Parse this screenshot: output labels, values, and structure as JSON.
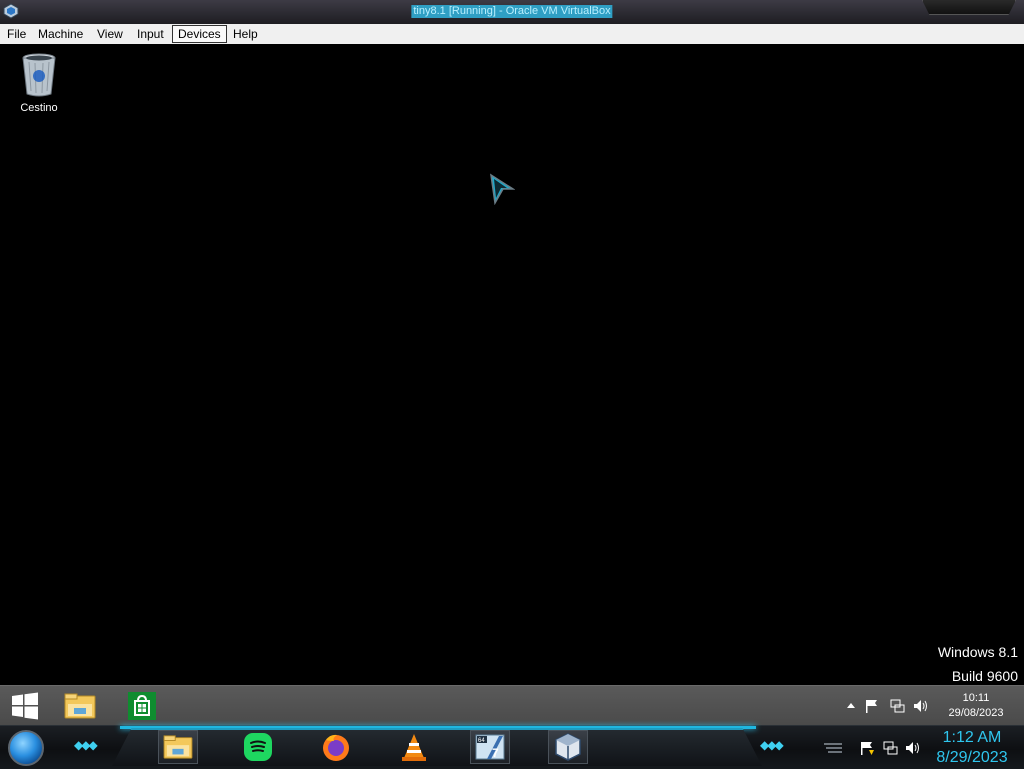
{
  "window": {
    "title": "tiny8.1 [Running] - Oracle VM VirtualBox"
  },
  "menubar": {
    "items": [
      {
        "label": "File"
      },
      {
        "label": "Machine"
      },
      {
        "label": "View"
      },
      {
        "label": "Input"
      },
      {
        "label": "Devices",
        "active": true
      },
      {
        "label": "Help"
      }
    ]
  },
  "desktop": {
    "icons": [
      {
        "label": "Cestino",
        "icon": "recycle-bin-icon"
      }
    ],
    "watermark": {
      "os": "Windows 8.1",
      "build": "Build 9600"
    }
  },
  "guest_taskbar": {
    "pinned": [
      {
        "icon": "windows-start-icon"
      },
      {
        "icon": "file-explorer-icon"
      },
      {
        "icon": "windows-store-icon"
      }
    ],
    "tray": {
      "icons": [
        "show-hidden-icons-chevron",
        "action-center-flag-icon",
        "network-icon",
        "volume-icon"
      ],
      "time": "10:11",
      "date": "29/08/2023"
    }
  },
  "host_taskbar": {
    "apps": [
      {
        "icon": "file-explorer-icon"
      },
      {
        "icon": "spotify-icon"
      },
      {
        "icon": "firefox-icon"
      },
      {
        "icon": "vlc-icon"
      },
      {
        "icon": "windows7-64-vm-icon"
      },
      {
        "icon": "virtualbox-icon"
      }
    ],
    "tray": {
      "icons": [
        "show-desktop-lines-icon",
        "action-center-flag-icon",
        "network-icon",
        "volume-icon"
      ],
      "time": "1:12 AM",
      "date": "8/29/2023"
    },
    "accent_color": "#2fc6ee"
  }
}
